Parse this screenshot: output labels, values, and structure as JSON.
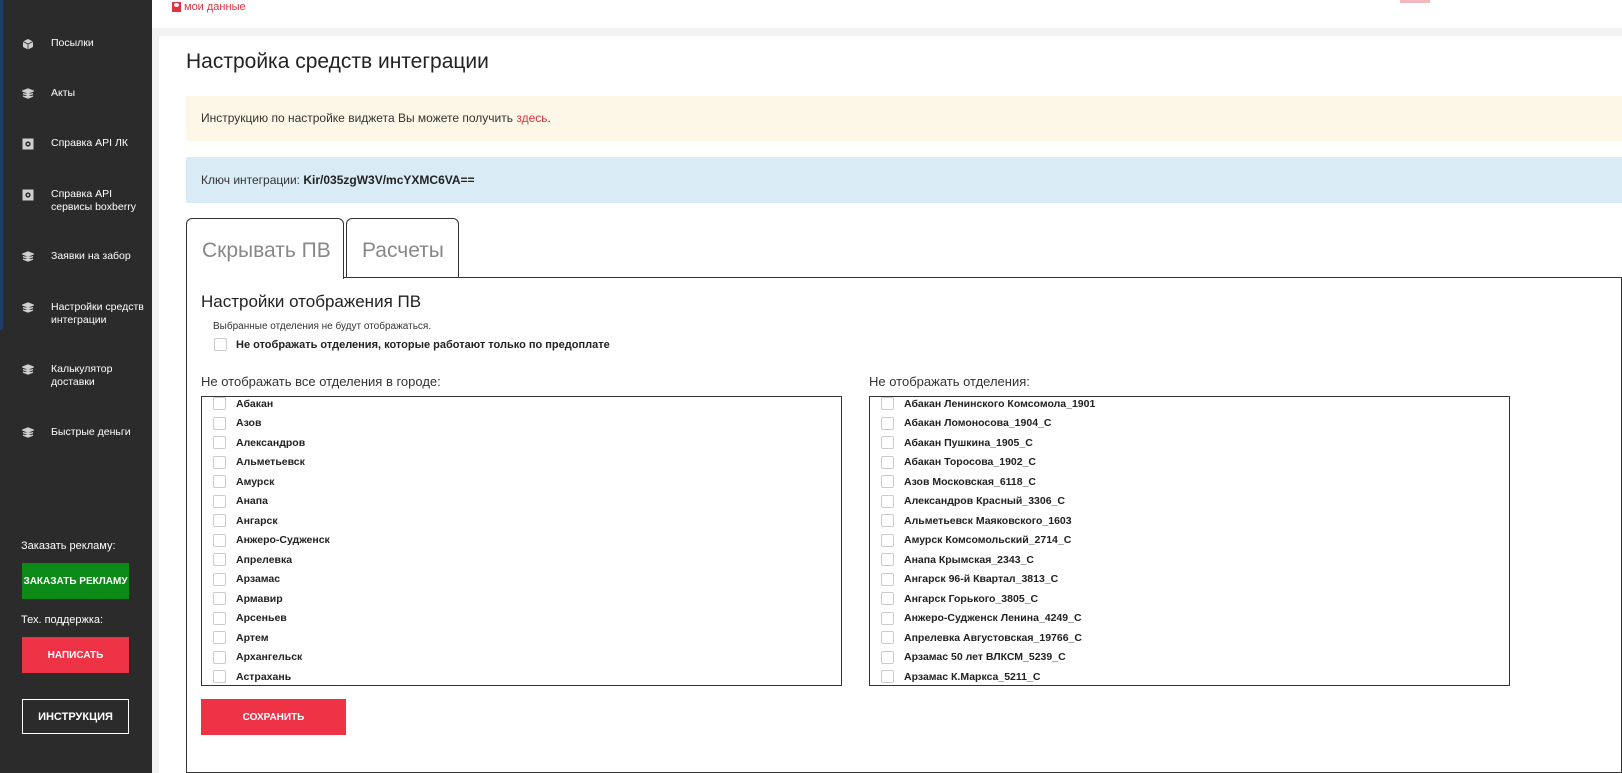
{
  "sidebar": {
    "items": [
      {
        "label": "Посылки",
        "icon": "box-icon"
      },
      {
        "label": "Акты",
        "icon": "stack-icon"
      },
      {
        "label": "Справка API ЛК",
        "icon": "gear-icon"
      },
      {
        "label": "Справка API сервисы boxberry",
        "icon": "gear-icon"
      },
      {
        "label": "Заявки на забор",
        "icon": "stack-icon"
      },
      {
        "label": "Настройки средств интеграции",
        "icon": "stack-icon"
      },
      {
        "label": "Калькулятор доставки",
        "icon": "stack-icon"
      },
      {
        "label": "Быстрые деньги",
        "icon": "stack-icon"
      }
    ],
    "ads_heading": "Заказать рекламу:",
    "ads_button": "Заказать рекламу",
    "support_heading": "Тех. поддержка:",
    "support_button": "Написать",
    "instruction_button": "Инструкция"
  },
  "header": {
    "my_data": "мои данные"
  },
  "main": {
    "title": "Настройка средств интеграции",
    "instruction_text": "Инструкцию по настройке виджета Вы можете получить ",
    "instruction_link": "здесь",
    "instruction_end": ".",
    "key_label": "Ключ интеграции: ",
    "key_value": "Kir/035zgW3V/mcYXMC6VA==",
    "tabs": [
      {
        "label": "Скрывать ПВ",
        "active": true
      },
      {
        "label": "Расчеты",
        "active": false
      }
    ],
    "panel": {
      "title": "Настройки отображения ПВ",
      "hint": "Выбранные отделения не будут отображаться.",
      "prepay_checkbox": "Не отображать отделения, которые работают только по предоплате",
      "cities_label": "Не отображать все отделения в городе:",
      "branches_label": "Не отображать отделения:",
      "cities": [
        "Абакан",
        "Азов",
        "Александров",
        "Альметьевск",
        "Амурск",
        "Анапа",
        "Ангарск",
        "Анжеро-Судженск",
        "Апрелевка",
        "Арзамас",
        "Армавир",
        "Арсеньев",
        "Артем",
        "Архангельск",
        "Астрахань"
      ],
      "branches": [
        "Абакан Ленинского Комсомола_1901",
        "Абакан Ломоносова_1904_С",
        "Абакан Пушкина_1905_С",
        "Абакан Торосова_1902_С",
        "Азов Московская_6118_С",
        "Александров Красный_3306_С",
        "Альметьевск Маяковского_1603",
        "Амурск Комсомольский_2714_С",
        "Анапа Крымская_2343_С",
        "Ангарск 96-й Квартал_3813_С",
        "Ангарск Горького_3805_С",
        "Анжеро-Судженск Ленина_4249_С",
        "Апрелевка Августовская_19766_С",
        "Арзамас 50 лет ВЛКСМ_5239_С",
        "Арзамас К.Маркса_5211_С"
      ],
      "save_button": "Сохранить"
    }
  },
  "colors": {
    "sidebar_bg": "#2b2b2b",
    "accent_red": "#ee3347",
    "ad_green": "#0b8a17",
    "alert_yellow": "#fcf7e6",
    "alert_blue": "#d9ebf5"
  }
}
